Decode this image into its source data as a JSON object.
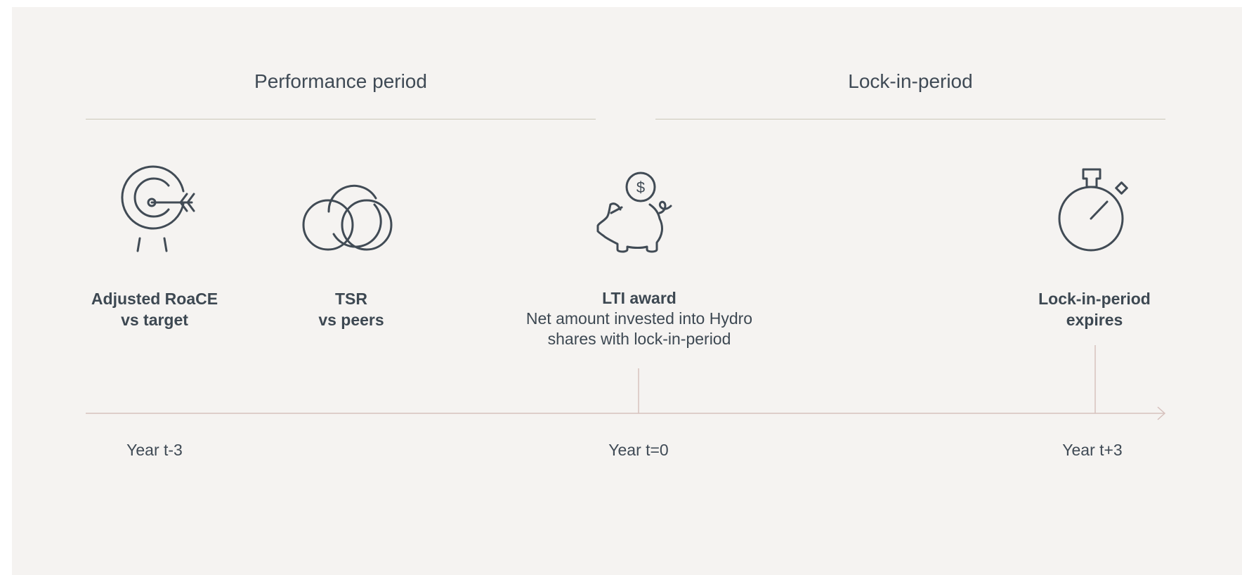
{
  "periods": {
    "performance": "Performance period",
    "lockin": "Lock-in-period"
  },
  "items": [
    {
      "icon": "target-icon",
      "bold1": "Adjusted RoaCE",
      "bold2": "vs target"
    },
    {
      "icon": "venn-icon",
      "bold1": "TSR",
      "bold2": "vs peers"
    },
    {
      "icon": "piggy-bank-icon",
      "bold1": "LTI award",
      "line2": "Net amount invested into Hydro",
      "line3": "shares with lock-in-period"
    },
    {
      "icon": "stopwatch-icon",
      "bold1": "Lock-in-period",
      "bold2": "expires"
    }
  ],
  "years": [
    "Year t-3",
    "Year t=0",
    "Year t+3"
  ],
  "icons": {
    "dollar_symbol": "$"
  },
  "colors": {
    "background": "#f5f3f1",
    "rule": "#cbc8b8",
    "timeline": "#d6c1bd",
    "text": "#3d4852"
  }
}
